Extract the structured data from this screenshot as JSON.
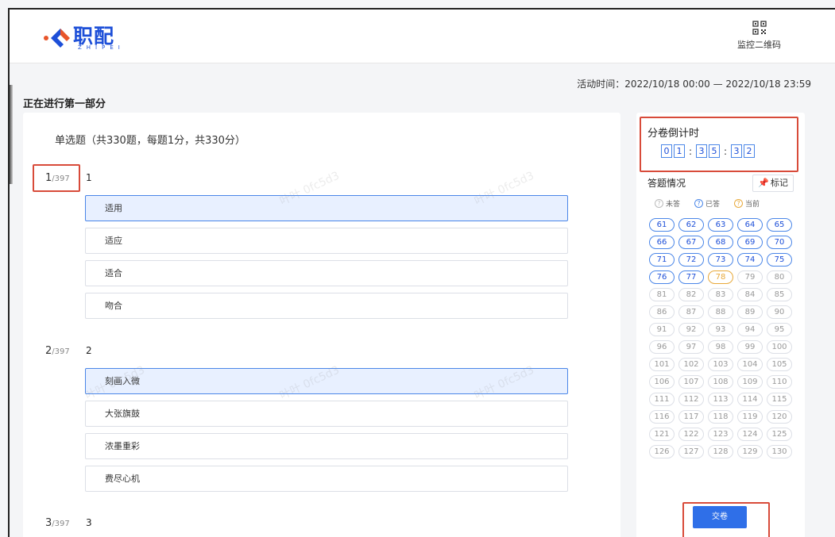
{
  "header": {
    "logo_text": "职配",
    "logo_sub": "ZHIPEI",
    "qr_label": "监控二维码",
    "qr_icon": "qr-code-icon"
  },
  "activity_time": "活动时间：2022/10/18 00:00 — 2022/10/18 23:59",
  "section_title": "正在进行第一部分",
  "question_type": "单选题（共330题，每题1分，共330分）",
  "watermark": "叶叶 0fc5d3",
  "questions": [
    {
      "num": "1",
      "total": "/397",
      "title": "1",
      "options": [
        "适用",
        "适应",
        "适合",
        "吻合"
      ],
      "selected": 0
    },
    {
      "num": "2",
      "total": "/397",
      "title": "2",
      "options": [
        "刻画入微",
        "大张旗鼓",
        "浓墨重彩",
        "费尽心机"
      ],
      "selected": 0
    },
    {
      "num": "3",
      "total": "/397",
      "title": "3",
      "options": []
    }
  ],
  "countdown": {
    "title": "分卷倒计时",
    "digits": [
      "0",
      "1",
      "3",
      "5",
      "3",
      "2"
    ]
  },
  "answer_status": {
    "title": "答题情况",
    "mark_label": "标记",
    "legend": [
      {
        "label": "未答",
        "kind": "none"
      },
      {
        "label": "已答",
        "kind": "done"
      },
      {
        "label": "当前",
        "kind": "cur"
      }
    ],
    "answered": [
      "61",
      "62",
      "63",
      "64",
      "65",
      "66",
      "67",
      "68",
      "69",
      "70",
      "71",
      "72",
      "73",
      "74",
      "75",
      "76",
      "77"
    ],
    "current": "78",
    "numbers": [
      "61",
      "62",
      "63",
      "64",
      "65",
      "66",
      "67",
      "68",
      "69",
      "70",
      "71",
      "72",
      "73",
      "74",
      "75",
      "76",
      "77",
      "78",
      "79",
      "80",
      "81",
      "82",
      "83",
      "84",
      "85",
      "86",
      "87",
      "88",
      "89",
      "90",
      "91",
      "92",
      "93",
      "94",
      "95",
      "96",
      "97",
      "98",
      "99",
      "100",
      "101",
      "102",
      "103",
      "104",
      "105",
      "106",
      "107",
      "108",
      "109",
      "110",
      "111",
      "112",
      "113",
      "114",
      "115",
      "116",
      "117",
      "118",
      "119",
      "120",
      "121",
      "122",
      "123",
      "124",
      "125",
      "126",
      "127",
      "128",
      "129",
      "130"
    ]
  },
  "submit_label": "交卷",
  "colors": {
    "accent": "#2f6fe8",
    "highlight": "#d84b3a",
    "current": "#e8a93a"
  }
}
